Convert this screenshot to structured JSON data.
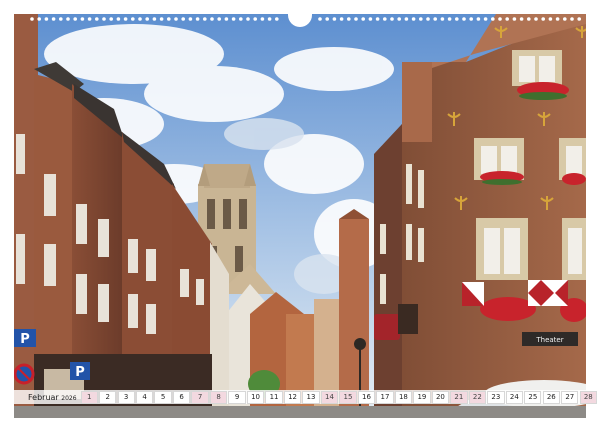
{
  "calendar": {
    "month": "Februar",
    "year": "2026",
    "days": [
      {
        "n": "1",
        "weekend": true
      },
      {
        "n": "2",
        "weekend": false
      },
      {
        "n": "3",
        "weekend": false
      },
      {
        "n": "4",
        "weekend": false
      },
      {
        "n": "5",
        "weekend": false
      },
      {
        "n": "6",
        "weekend": false
      },
      {
        "n": "7",
        "weekend": true
      },
      {
        "n": "8",
        "weekend": true
      },
      {
        "n": "9",
        "weekend": false
      },
      {
        "n": "10",
        "weekend": false
      },
      {
        "n": "11",
        "weekend": false
      },
      {
        "n": "12",
        "weekend": false
      },
      {
        "n": "13",
        "weekend": false
      },
      {
        "n": "14",
        "weekend": true
      },
      {
        "n": "15",
        "weekend": true
      },
      {
        "n": "16",
        "weekend": false
      },
      {
        "n": "17",
        "weekend": false
      },
      {
        "n": "18",
        "weekend": false
      },
      {
        "n": "19",
        "weekend": false
      },
      {
        "n": "20",
        "weekend": false
      },
      {
        "n": "21",
        "weekend": true
      },
      {
        "n": "22",
        "weekend": true
      },
      {
        "n": "23",
        "weekend": false
      },
      {
        "n": "24",
        "weekend": false
      },
      {
        "n": "25",
        "weekend": false
      },
      {
        "n": "26",
        "weekend": false
      },
      {
        "n": "27",
        "weekend": false
      },
      {
        "n": "28",
        "weekend": true
      }
    ]
  },
  "signs": {
    "theater": "Theater"
  },
  "colors": {
    "sky": "#6e9fd6",
    "brick": "#9a5a3e",
    "tower": "#c8b596",
    "weekend": "#f3d9e0"
  }
}
